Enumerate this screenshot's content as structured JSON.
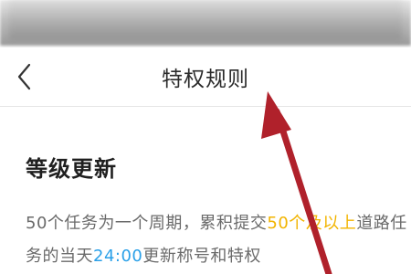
{
  "nav": {
    "back_icon": "chevron-left-icon",
    "title": "特权规则"
  },
  "section": {
    "title": "等级更新"
  },
  "rule": {
    "line1": [
      {
        "text": "50个任务为一个周期，累积提交",
        "style": "normal"
      },
      {
        "text": "50个及以上",
        "style": "yellow"
      },
      {
        "text": "道路任",
        "style": "normal"
      }
    ],
    "line2": [
      {
        "text": "务的当天",
        "style": "normal"
      },
      {
        "text": "24:00",
        "style": "blue"
      },
      {
        "text": "更新称号和特权",
        "style": "normal"
      }
    ]
  },
  "colors": {
    "highlight_yellow": "#f2b400",
    "highlight_blue": "#2aa0e8",
    "annotation_arrow": "#b0212b"
  }
}
